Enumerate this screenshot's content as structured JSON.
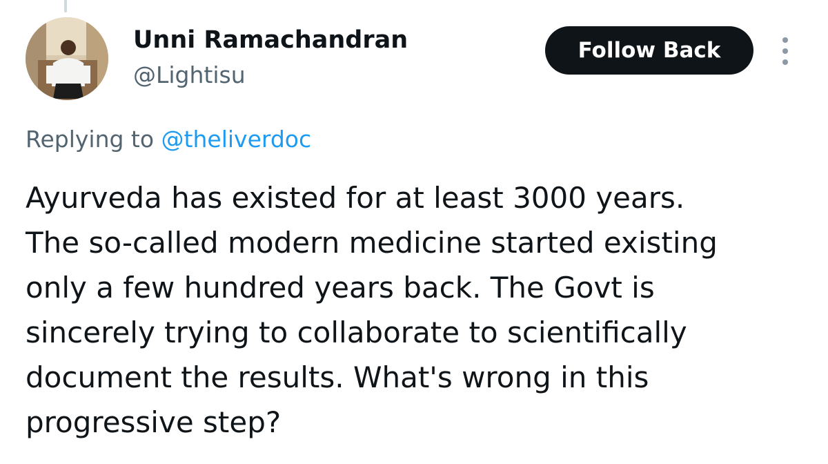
{
  "author": {
    "display_name": "Unni Ramachandran",
    "handle": "@Lightisu",
    "avatar_icon": "profile-photo"
  },
  "actions": {
    "follow_label": "Follow Back",
    "more_icon": "vertical-ellipsis-icon"
  },
  "reply": {
    "prefix": "Replying to ",
    "mention": "@theliverdoc"
  },
  "tweet": {
    "lines": [
      "Ayurveda has existed for at least 3000 years.",
      "The so-called modern medicine started existing",
      "only a few hundred years back. The Govt is",
      "sincerely trying to collaborate to scientifically",
      "document the results. What's wrong in this",
      "progressive step?"
    ]
  },
  "colors": {
    "text_primary": "#0f1419",
    "text_secondary": "#536471",
    "link": "#1d9bf0",
    "button_bg": "#0f1419",
    "button_text": "#ffffff",
    "thread_line": "#cfd9de"
  }
}
